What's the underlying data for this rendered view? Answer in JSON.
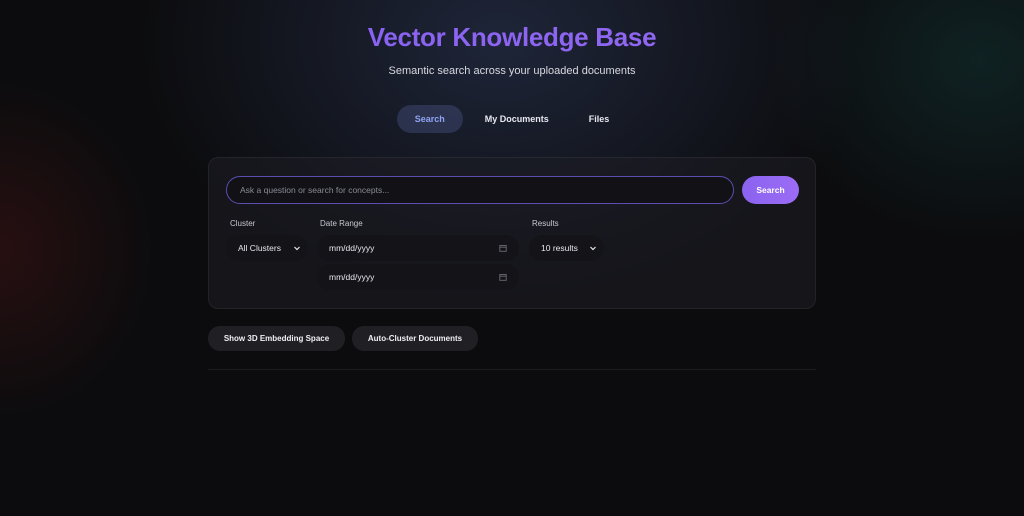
{
  "header": {
    "title": "Vector Knowledge Base",
    "subtitle": "Semantic search across your uploaded documents"
  },
  "tabs": [
    {
      "label": "Search",
      "active": true
    },
    {
      "label": "My Documents",
      "active": false
    },
    {
      "label": "Files",
      "active": false
    }
  ],
  "search": {
    "placeholder": "Ask a question or search for concepts...",
    "value": "",
    "button_label": "Search"
  },
  "filters": {
    "cluster_label": "Cluster",
    "cluster_value": "All Clusters",
    "date_range_label": "Date Range",
    "date_from": "mm/dd/yyyy",
    "date_to": "mm/dd/yyyy",
    "results_label": "Results",
    "results_value": "10 results"
  },
  "actions": {
    "embedding_label": "Show 3D Embedding Space",
    "cluster_label": "Auto-Cluster Documents"
  },
  "colors": {
    "accent": "#8a63f0",
    "tab_active_text": "#8fa3f2",
    "background": "#0c0c0e"
  },
  "icons": {
    "select_caret": "chevron-down-icon",
    "date_picker": "calendar-icon"
  }
}
